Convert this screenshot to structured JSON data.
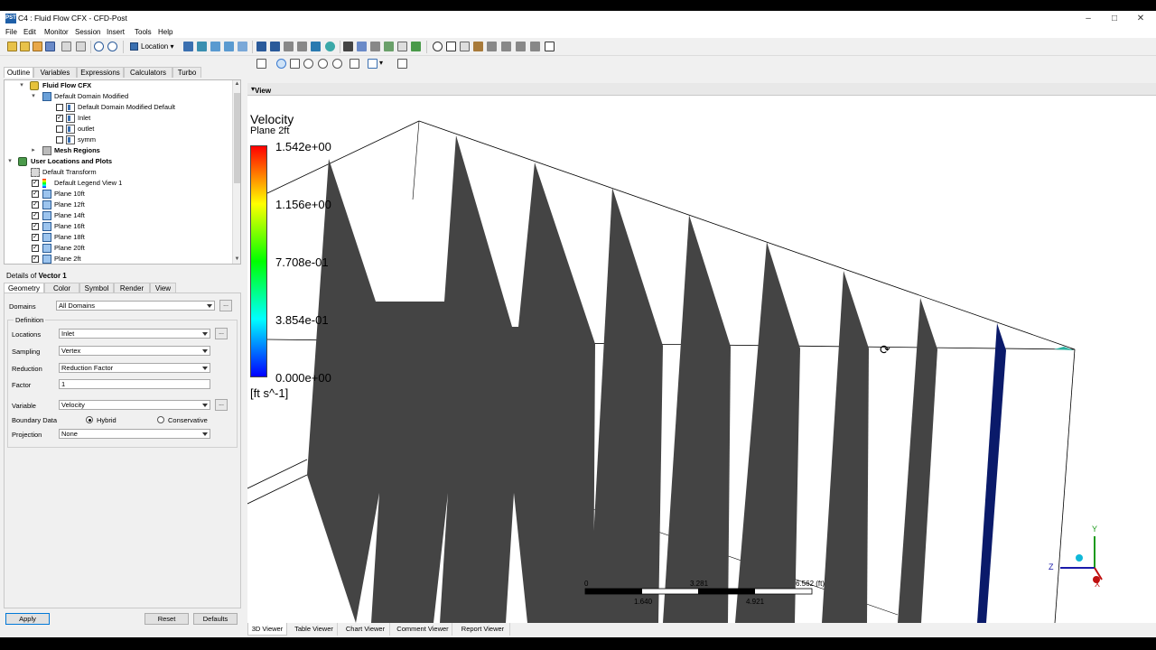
{
  "window": {
    "title": "C4 : Fluid Flow CFX - CFD-Post",
    "app_icon_text": "PST"
  },
  "menu": [
    "File",
    "Edit",
    "Monitor",
    "Session",
    "Insert",
    "Tools",
    "Help"
  ],
  "toolbar": {
    "location_label": "Location"
  },
  "outline_tabs": [
    "Outline",
    "Variables",
    "Expressions",
    "Calculators",
    "Turbo"
  ],
  "tree": {
    "fluid_flow": "Fluid Flow CFX",
    "domain": "Default Domain Modified",
    "boundaries": [
      {
        "label": "Default Domain Modified Default",
        "checked": false
      },
      {
        "label": "Inlet",
        "checked": true
      },
      {
        "label": "outlet",
        "checked": false
      },
      {
        "label": "symm",
        "checked": false
      }
    ],
    "mesh_regions": "Mesh Regions",
    "user_locations": "User Locations and Plots",
    "default_transform": "Default Transform",
    "items": [
      {
        "label": "Default Legend View 1",
        "checked": true
      },
      {
        "label": "Plane 10ft",
        "checked": true
      },
      {
        "label": "Plane 12ft",
        "checked": true
      },
      {
        "label": "Plane 14ft",
        "checked": true
      },
      {
        "label": "Plane 16ft",
        "checked": true
      },
      {
        "label": "Plane 18ft",
        "checked": true
      },
      {
        "label": "Plane 20ft",
        "checked": true
      },
      {
        "label": "Plane 2ft",
        "checked": true
      }
    ]
  },
  "details": {
    "title_prefix": "Details of",
    "title_object": "Vector 1",
    "tabs": [
      "Geometry",
      "Color",
      "Symbol",
      "Render",
      "View"
    ],
    "domains_label": "Domains",
    "domains_value": "All Domains",
    "definition_label": "Definition",
    "locations_label": "Locations",
    "locations_value": "Inlet",
    "sampling_label": "Sampling",
    "sampling_value": "Vertex",
    "reduction_label": "Reduction",
    "reduction_value": "Reduction Factor",
    "factor_label": "Factor",
    "factor_value": "1",
    "variable_label": "Variable",
    "variable_value": "Velocity",
    "boundary_label": "Boundary Data",
    "boundary_opt1": "Hybrid",
    "boundary_opt2": "Conservative",
    "projection_label": "Projection",
    "projection_value": "None",
    "dots": "..."
  },
  "buttons": {
    "apply": "Apply",
    "reset": "Reset",
    "defaults": "Defaults"
  },
  "viewer": {
    "view_name": "View 1",
    "legend": {
      "title": "Velocity",
      "subtitle": "Plane 2ft",
      "values": [
        "1.542e+00",
        "1.156e+00",
        "7.708e-01",
        "3.854e-01",
        "0.000e+00"
      ],
      "unit": "[ft s^-1]"
    },
    "scale_top": [
      "0",
      "3.281",
      "6.562 (ft)"
    ],
    "scale_bottom": [
      "1.640",
      "4.921"
    ],
    "axes": {
      "x": "X",
      "y": "Y",
      "z": "Z"
    },
    "bottom_tabs": [
      "3D Viewer",
      "Table Viewer",
      "Chart Viewer",
      "Comment Viewer",
      "Report Viewer"
    ]
  },
  "colors": {
    "plane_fill": "#444444",
    "accent": "#0078d7",
    "inlet_vector": "#0a1a6a"
  }
}
